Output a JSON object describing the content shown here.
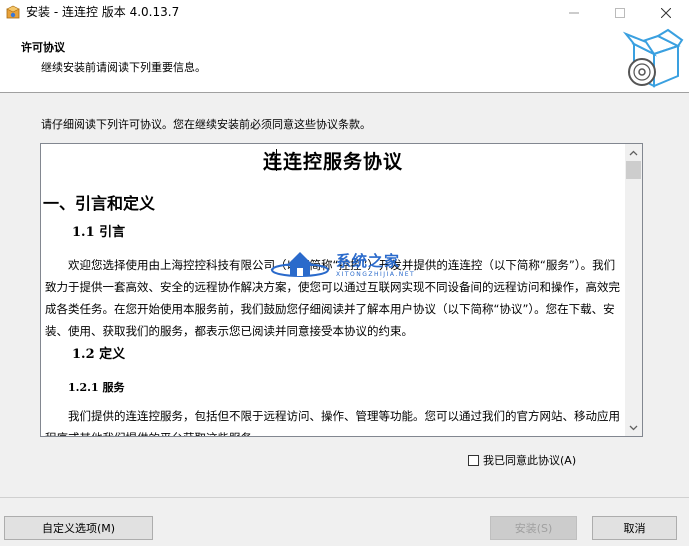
{
  "window": {
    "title": "安装 - 连连控 版本 4.0.13.7"
  },
  "header": {
    "title": "许可协议",
    "subtitle": "继续安装前请阅读下列重要信息。"
  },
  "instructions": "请仔细阅读下列许可协议。您在继续安装前必须同意这些协议条款。",
  "license": {
    "title": "连连控服务协议",
    "section1": "一、引言和定义",
    "section1_1": "1.1  引言",
    "para1": "欢迎您选择使用由上海控控科技有限公司（以下简称“控控”）开发并提供的连连控（以下简称“服务”）。我们致力于提供一套高效、安全的远程协作解决方案，使您可以通过互联网实现不同设备间的远程访问和操作，高效完成各类任务。在您开始使用本服务前，我们鼓励您仔细阅读并了解本用户协议（以下简称“协议”）。您在下载、安装、使用、获取我们的服务，都表示您已阅读并同意接受本协议的约束。",
    "section1_2": "1.2  定义",
    "section1_2_1": "1.2.1  服务",
    "para2": "我们提供的连连控服务，包括但不限于远程访问、操作、管理等功能。您可以通过我们的官方网站、移动应用程序或其他我们提供的平台获取这些服务。"
  },
  "watermark": {
    "brand": "系统之家",
    "sub": "XITONGZHIJIA.NET"
  },
  "agree": {
    "label": "我已同意此协议(A)",
    "checked": false
  },
  "buttons": {
    "custom": "自定义选项(M)",
    "install": "安装(S)",
    "cancel": "取消"
  },
  "icons": {
    "app": "installer-box-icon",
    "header": "box-disc-icon",
    "minimize": "minimize-icon",
    "maximize": "maximize-icon",
    "close": "close-icon",
    "scroll_up": "chevron-up-icon",
    "scroll_down": "chevron-down-icon"
  },
  "colors": {
    "accent": "#2a6acb",
    "icon_blue": "#3aa0e0"
  }
}
